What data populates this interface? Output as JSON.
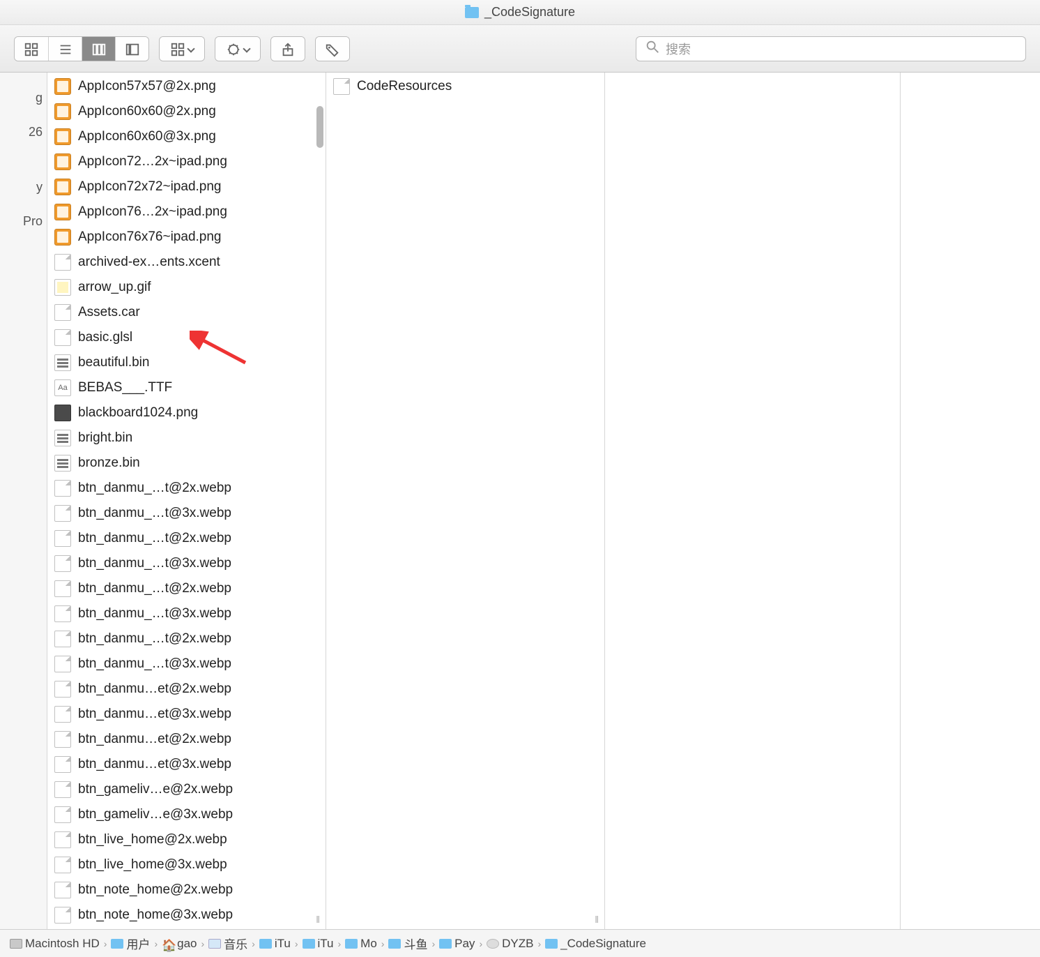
{
  "title": "_CodeSignature",
  "toolbar": {
    "search_placeholder": "搜索"
  },
  "sidebar_fragments": [
    "g",
    "26",
    "y",
    "Pro"
  ],
  "column1_files": [
    {
      "name": "AppIcon57x57@2x.png",
      "icon": "png"
    },
    {
      "name": "AppIcon60x60@2x.png",
      "icon": "png"
    },
    {
      "name": "AppIcon60x60@3x.png",
      "icon": "png"
    },
    {
      "name": "AppIcon72…2x~ipad.png",
      "icon": "png"
    },
    {
      "name": "AppIcon72x72~ipad.png",
      "icon": "png"
    },
    {
      "name": "AppIcon76…2x~ipad.png",
      "icon": "png"
    },
    {
      "name": "AppIcon76x76~ipad.png",
      "icon": "png"
    },
    {
      "name": "archived-ex…ents.xcent",
      "icon": "blank"
    },
    {
      "name": "arrow_up.gif",
      "icon": "gif"
    },
    {
      "name": "Assets.car",
      "icon": "blank"
    },
    {
      "name": "basic.glsl",
      "icon": "blank"
    },
    {
      "name": "beautiful.bin",
      "icon": "bin"
    },
    {
      "name": "BEBAS___.TTF",
      "icon": "ttf"
    },
    {
      "name": "blackboard1024.png",
      "icon": "img"
    },
    {
      "name": "bright.bin",
      "icon": "bin"
    },
    {
      "name": "bronze.bin",
      "icon": "bin"
    },
    {
      "name": "btn_danmu_…t@2x.webp",
      "icon": "blank"
    },
    {
      "name": "btn_danmu_…t@3x.webp",
      "icon": "blank"
    },
    {
      "name": "btn_danmu_…t@2x.webp",
      "icon": "blank"
    },
    {
      "name": "btn_danmu_…t@3x.webp",
      "icon": "blank"
    },
    {
      "name": "btn_danmu_…t@2x.webp",
      "icon": "blank"
    },
    {
      "name": "btn_danmu_…t@3x.webp",
      "icon": "blank"
    },
    {
      "name": "btn_danmu_…t@2x.webp",
      "icon": "blank"
    },
    {
      "name": "btn_danmu_…t@3x.webp",
      "icon": "blank"
    },
    {
      "name": "btn_danmu…et@2x.webp",
      "icon": "blank"
    },
    {
      "name": "btn_danmu…et@3x.webp",
      "icon": "blank"
    },
    {
      "name": "btn_danmu…et@2x.webp",
      "icon": "blank"
    },
    {
      "name": "btn_danmu…et@3x.webp",
      "icon": "blank"
    },
    {
      "name": "btn_gameliv…e@2x.webp",
      "icon": "blank"
    },
    {
      "name": "btn_gameliv…e@3x.webp",
      "icon": "blank"
    },
    {
      "name": "btn_live_home@2x.webp",
      "icon": "blank"
    },
    {
      "name": "btn_live_home@3x.webp",
      "icon": "blank"
    },
    {
      "name": "btn_note_home@2x.webp",
      "icon": "blank"
    },
    {
      "name": "btn_note_home@3x.webp",
      "icon": "blank"
    }
  ],
  "column2_files": [
    {
      "name": "CodeResources",
      "icon": "blank"
    }
  ],
  "pathbar": [
    {
      "label": "Macintosh HD",
      "icon": "disk"
    },
    {
      "label": "用户",
      "icon": "folder"
    },
    {
      "label": "gao",
      "icon": "home"
    },
    {
      "label": "音乐",
      "icon": "music"
    },
    {
      "label": "iTu",
      "icon": "folder"
    },
    {
      "label": "iTu",
      "icon": "folder"
    },
    {
      "label": "Mo",
      "icon": "folder"
    },
    {
      "label": "斗鱼",
      "icon": "folder"
    },
    {
      "label": "Pay",
      "icon": "folder"
    },
    {
      "label": "DYZB",
      "icon": "gray"
    },
    {
      "label": "_CodeSignature",
      "icon": "folder"
    }
  ]
}
